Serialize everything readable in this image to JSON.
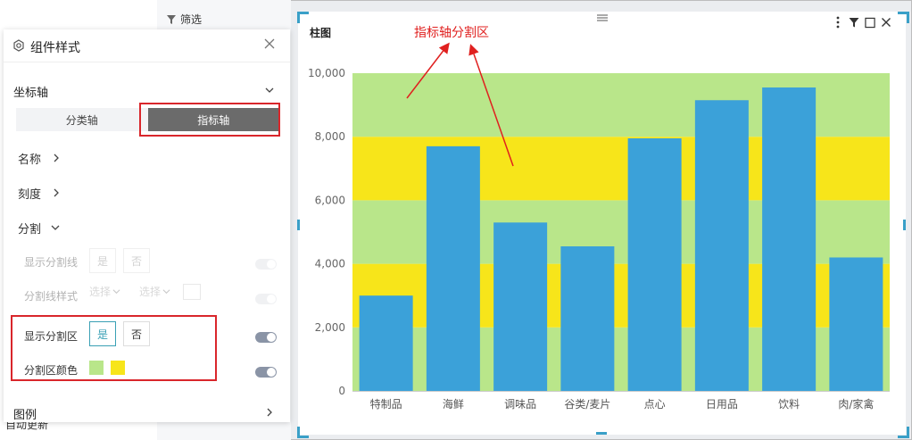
{
  "background": {
    "bottom_text": "自动更新",
    "filter_label": "筛选"
  },
  "panel": {
    "title": "组件样式",
    "axis_section": "坐标轴",
    "tabs": [
      {
        "label": "分类轴",
        "active": false
      },
      {
        "label": "指标轴",
        "active": true
      }
    ],
    "rows": {
      "name": "名称",
      "scale": "刻度",
      "split": "分割"
    },
    "split_options": {
      "show_split_line": {
        "label": "显示分割线",
        "yes": "是",
        "no": "否",
        "toggle_on": false
      },
      "split_line_style": {
        "label": "分割线样式",
        "select1": "选择",
        "select2": "选择",
        "toggle_on": false
      },
      "show_split_area": {
        "label": "显示分割区",
        "yes": "是",
        "no": "否",
        "selected": "是",
        "toggle_on": true
      },
      "split_area_color": {
        "label": "分割区颜色",
        "colors": [
          "#b9e68a",
          "#f7e51a"
        ],
        "toggle_on": true
      }
    },
    "legend_section": "图例"
  },
  "chart_card": {
    "title": "柱图",
    "annotation": "指标轴分割区",
    "tools": [
      "more-vertical-icon",
      "filter-icon",
      "maximize-icon",
      "close-icon"
    ]
  },
  "colors": {
    "bar": "#3ba1d9",
    "band_green": "#b9e68a",
    "band_yellow": "#f7e51a",
    "highlight_red": "#d9262b",
    "accent": "#3aa0b5"
  },
  "chart_data": {
    "type": "bar",
    "categories": [
      "特制品",
      "海鲜",
      "调味品",
      "谷类/麦片",
      "点心",
      "日用品",
      "饮料",
      "肉/家禽"
    ],
    "values": [
      3000,
      7700,
      5300,
      4550,
      7950,
      9150,
      9550,
      4200
    ],
    "ylim": [
      0,
      10000
    ],
    "yticks": [
      "0",
      "2,000",
      "4,000",
      "6,000",
      "8,000",
      "10,000"
    ],
    "split_area_colors": [
      "#b9e68a",
      "#f7e51a"
    ],
    "grid": false,
    "legend": "none"
  }
}
